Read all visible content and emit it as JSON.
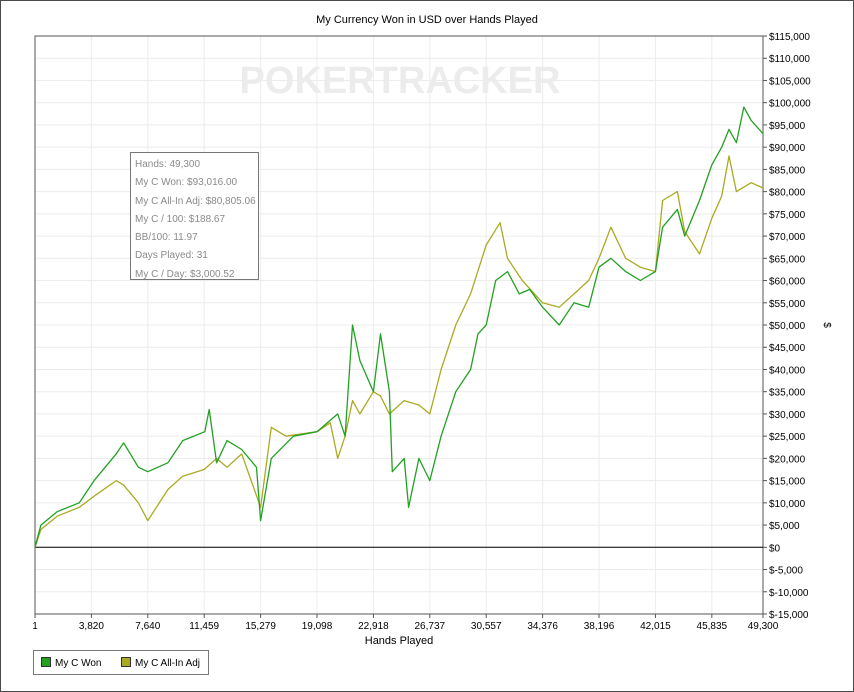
{
  "chart_data": {
    "type": "line",
    "title": "My Currency Won in USD over Hands Played",
    "xlabel": "Hands Played",
    "ylabel": "$",
    "xlim": [
      1,
      49300
    ],
    "ylim": [
      -15000,
      115000
    ],
    "x_ticks": [
      "1",
      "3,820",
      "7,640",
      "11,459",
      "15,279",
      "19,098",
      "22,918",
      "26,737",
      "30,557",
      "34,376",
      "38,196",
      "42,015",
      "45,835",
      "49,300"
    ],
    "y_ticks": [
      "$115,000",
      "$110,000",
      "$105,000",
      "$100,000",
      "$95,000",
      "$90,000",
      "$85,000",
      "$80,000",
      "$75,000",
      "$70,000",
      "$65,000",
      "$60,000",
      "$55,000",
      "$50,000",
      "$45,000",
      "$40,000",
      "$35,000",
      "$30,000",
      "$25,000",
      "$20,000",
      "$15,000",
      "$10,000",
      "$5,000",
      "$0",
      "$-5,000",
      "$-10,000",
      "$-15,000"
    ],
    "grid": true,
    "legend_position": "bottom-left",
    "watermark": "POKERTRACKER",
    "series": [
      {
        "name": "My C Won",
        "color": "#22a022",
        "points": [
          [
            1,
            0
          ],
          [
            400,
            5000
          ],
          [
            1500,
            8000
          ],
          [
            3000,
            10000
          ],
          [
            4000,
            15000
          ],
          [
            5500,
            21000
          ],
          [
            6000,
            23500
          ],
          [
            7000,
            18000
          ],
          [
            7640,
            17000
          ],
          [
            9000,
            19000
          ],
          [
            10000,
            24000
          ],
          [
            11500,
            26000
          ],
          [
            11800,
            31000
          ],
          [
            12300,
            19000
          ],
          [
            13000,
            24000
          ],
          [
            14000,
            22000
          ],
          [
            15000,
            18000
          ],
          [
            15279,
            6000
          ],
          [
            16000,
            20000
          ],
          [
            17500,
            25000
          ],
          [
            19098,
            26000
          ],
          [
            20500,
            30000
          ],
          [
            21000,
            25000
          ],
          [
            21500,
            50000
          ],
          [
            22000,
            42000
          ],
          [
            22918,
            35000
          ],
          [
            23400,
            48000
          ],
          [
            24000,
            35000
          ],
          [
            24200,
            17000
          ],
          [
            25000,
            20000
          ],
          [
            25300,
            9000
          ],
          [
            26000,
            20000
          ],
          [
            26737,
            15000
          ],
          [
            27500,
            25000
          ],
          [
            28500,
            35000
          ],
          [
            29500,
            40000
          ],
          [
            30000,
            48000
          ],
          [
            30557,
            50000
          ],
          [
            31200,
            60000
          ],
          [
            32000,
            62000
          ],
          [
            32800,
            57000
          ],
          [
            33500,
            58000
          ],
          [
            34376,
            54000
          ],
          [
            35500,
            50000
          ],
          [
            36500,
            55000
          ],
          [
            37500,
            54000
          ],
          [
            38196,
            63000
          ],
          [
            39000,
            65000
          ],
          [
            40000,
            62000
          ],
          [
            41000,
            60000
          ],
          [
            42015,
            62000
          ],
          [
            42500,
            72000
          ],
          [
            43500,
            76000
          ],
          [
            44000,
            70000
          ],
          [
            45000,
            78000
          ],
          [
            45835,
            86000
          ],
          [
            46500,
            90000
          ],
          [
            47000,
            94000
          ],
          [
            47500,
            91000
          ],
          [
            48000,
            99000
          ],
          [
            48500,
            96000
          ],
          [
            49300,
            93016
          ]
        ]
      },
      {
        "name": "My C All-In Adj",
        "color": "#aaaa22",
        "points": [
          [
            1,
            0
          ],
          [
            400,
            4000
          ],
          [
            1500,
            7000
          ],
          [
            3000,
            9000
          ],
          [
            4000,
            11500
          ],
          [
            5500,
            15000
          ],
          [
            6000,
            14000
          ],
          [
            7000,
            10000
          ],
          [
            7640,
            6000
          ],
          [
            9000,
            13000
          ],
          [
            10000,
            16000
          ],
          [
            11459,
            17500
          ],
          [
            12300,
            20000
          ],
          [
            13000,
            18000
          ],
          [
            14000,
            21000
          ],
          [
            15279,
            9000
          ],
          [
            16000,
            27000
          ],
          [
            17000,
            25000
          ],
          [
            19098,
            26000
          ],
          [
            20000,
            28000
          ],
          [
            20500,
            20000
          ],
          [
            21000,
            25000
          ],
          [
            21500,
            33000
          ],
          [
            22000,
            30000
          ],
          [
            22918,
            35000
          ],
          [
            23400,
            34000
          ],
          [
            24000,
            30000
          ],
          [
            25000,
            33000
          ],
          [
            26000,
            32000
          ],
          [
            26737,
            30000
          ],
          [
            27500,
            40000
          ],
          [
            28500,
            50000
          ],
          [
            29500,
            57000
          ],
          [
            30557,
            68000
          ],
          [
            31500,
            73000
          ],
          [
            32000,
            65000
          ],
          [
            33000,
            60000
          ],
          [
            34376,
            55000
          ],
          [
            35500,
            54000
          ],
          [
            36500,
            57000
          ],
          [
            37500,
            60000
          ],
          [
            38196,
            65000
          ],
          [
            39000,
            72000
          ],
          [
            40000,
            65000
          ],
          [
            41000,
            63000
          ],
          [
            42015,
            62000
          ],
          [
            42500,
            78000
          ],
          [
            43500,
            80000
          ],
          [
            44000,
            71000
          ],
          [
            45000,
            66000
          ],
          [
            45835,
            74000
          ],
          [
            46500,
            79000
          ],
          [
            47000,
            88000
          ],
          [
            47500,
            80000
          ],
          [
            48500,
            82000
          ],
          [
            49300,
            80805
          ]
        ]
      }
    ]
  },
  "tooltip": {
    "hands": "Hands: 49,300",
    "won": "My C Won: $93,016.00",
    "allin": "My C All-In Adj: $80,805.06",
    "per100": "My C / 100: $188.67",
    "bb100": "BB/100: 11.97",
    "days": "Days Played: 31",
    "perday": "My C / Day: $3,000.52"
  },
  "legend": {
    "won_label": "My C Won",
    "allin_label": "My C All-In Adj"
  }
}
